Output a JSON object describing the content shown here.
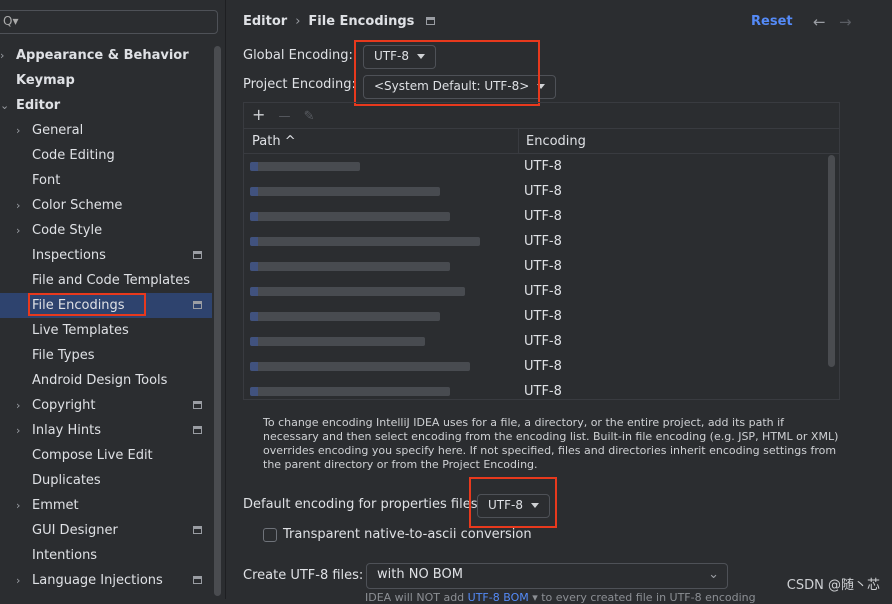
{
  "sidebar": {
    "search_placeholder": "Q▾",
    "items": [
      {
        "label": "Appearance & Behavior",
        "bold": true,
        "chev": "›",
        "level": 0
      },
      {
        "label": "Keymap",
        "bold": true,
        "level": 0
      },
      {
        "label": "Editor",
        "bold": true,
        "chev": "⌄",
        "level": 0
      },
      {
        "label": "General",
        "chev": "›",
        "level": 1
      },
      {
        "label": "Code Editing",
        "level": 1
      },
      {
        "label": "Font",
        "level": 1
      },
      {
        "label": "Color Scheme",
        "chev": "›",
        "level": 1
      },
      {
        "label": "Code Style",
        "chev": "›",
        "level": 1
      },
      {
        "label": "Inspections",
        "level": 1,
        "pin": true
      },
      {
        "label": "File and Code Templates",
        "level": 1
      },
      {
        "label": "File Encodings",
        "level": 1,
        "pin": true,
        "selected": true
      },
      {
        "label": "Live Templates",
        "level": 1
      },
      {
        "label": "File Types",
        "level": 1
      },
      {
        "label": "Android Design Tools",
        "level": 1
      },
      {
        "label": "Copyright",
        "chev": "›",
        "level": 1,
        "pin": true
      },
      {
        "label": "Inlay Hints",
        "chev": "›",
        "level": 1,
        "pin": true
      },
      {
        "label": "Compose Live Edit",
        "level": 1
      },
      {
        "label": "Duplicates",
        "level": 1
      },
      {
        "label": "Emmet",
        "chev": "›",
        "level": 1
      },
      {
        "label": "GUI Designer",
        "level": 1,
        "pin": true
      },
      {
        "label": "Intentions",
        "level": 1
      },
      {
        "label": "Language Injections",
        "chev": "›",
        "level": 1,
        "pin": true
      }
    ]
  },
  "header": {
    "crumb1": "Editor",
    "crumb2": "File Encodings",
    "reset": "Reset",
    "back": "←",
    "forward": "→"
  },
  "global": {
    "label": "Global Encoding:",
    "value": "UTF-8"
  },
  "project": {
    "label": "Project Encoding:",
    "value": "<System Default: UTF-8>"
  },
  "table": {
    "add": "+",
    "remove": "—",
    "edit": "✎",
    "col_path": "Path ^",
    "col_encoding": "Encoding",
    "rows": [
      "UTF-8",
      "UTF-8",
      "UTF-8",
      "UTF-8",
      "UTF-8",
      "UTF-8",
      "UTF-8",
      "UTF-8",
      "UTF-8",
      "UTF-8"
    ]
  },
  "help": "To change encoding IntelliJ IDEA uses for a file, a directory, or the entire project, add its path if necessary and then select encoding from the encoding list. Built-in file encoding (e.g. JSP, HTML or XML) overrides encoding you specify here. If not specified, files and directories inherit encoding settings from the parent directory or from the Project Encoding.",
  "properties": {
    "label": "Default encoding for properties files:",
    "value": "UTF-8"
  },
  "transparent": {
    "label": "Transparent native-to-ascii conversion",
    "checked": false
  },
  "bom": {
    "label": "Create UTF-8 files:",
    "value": "with NO BOM",
    "note_pre": "IDEA will NOT add ",
    "note_link": "UTF-8 BOM",
    "note_post": " ▾ to every created file in UTF-8 encoding"
  },
  "watermark": "CSDN @随丶芯",
  "colors": {
    "accent": "#548af7",
    "selection": "#2e436e",
    "highlight": "#e8391d"
  }
}
